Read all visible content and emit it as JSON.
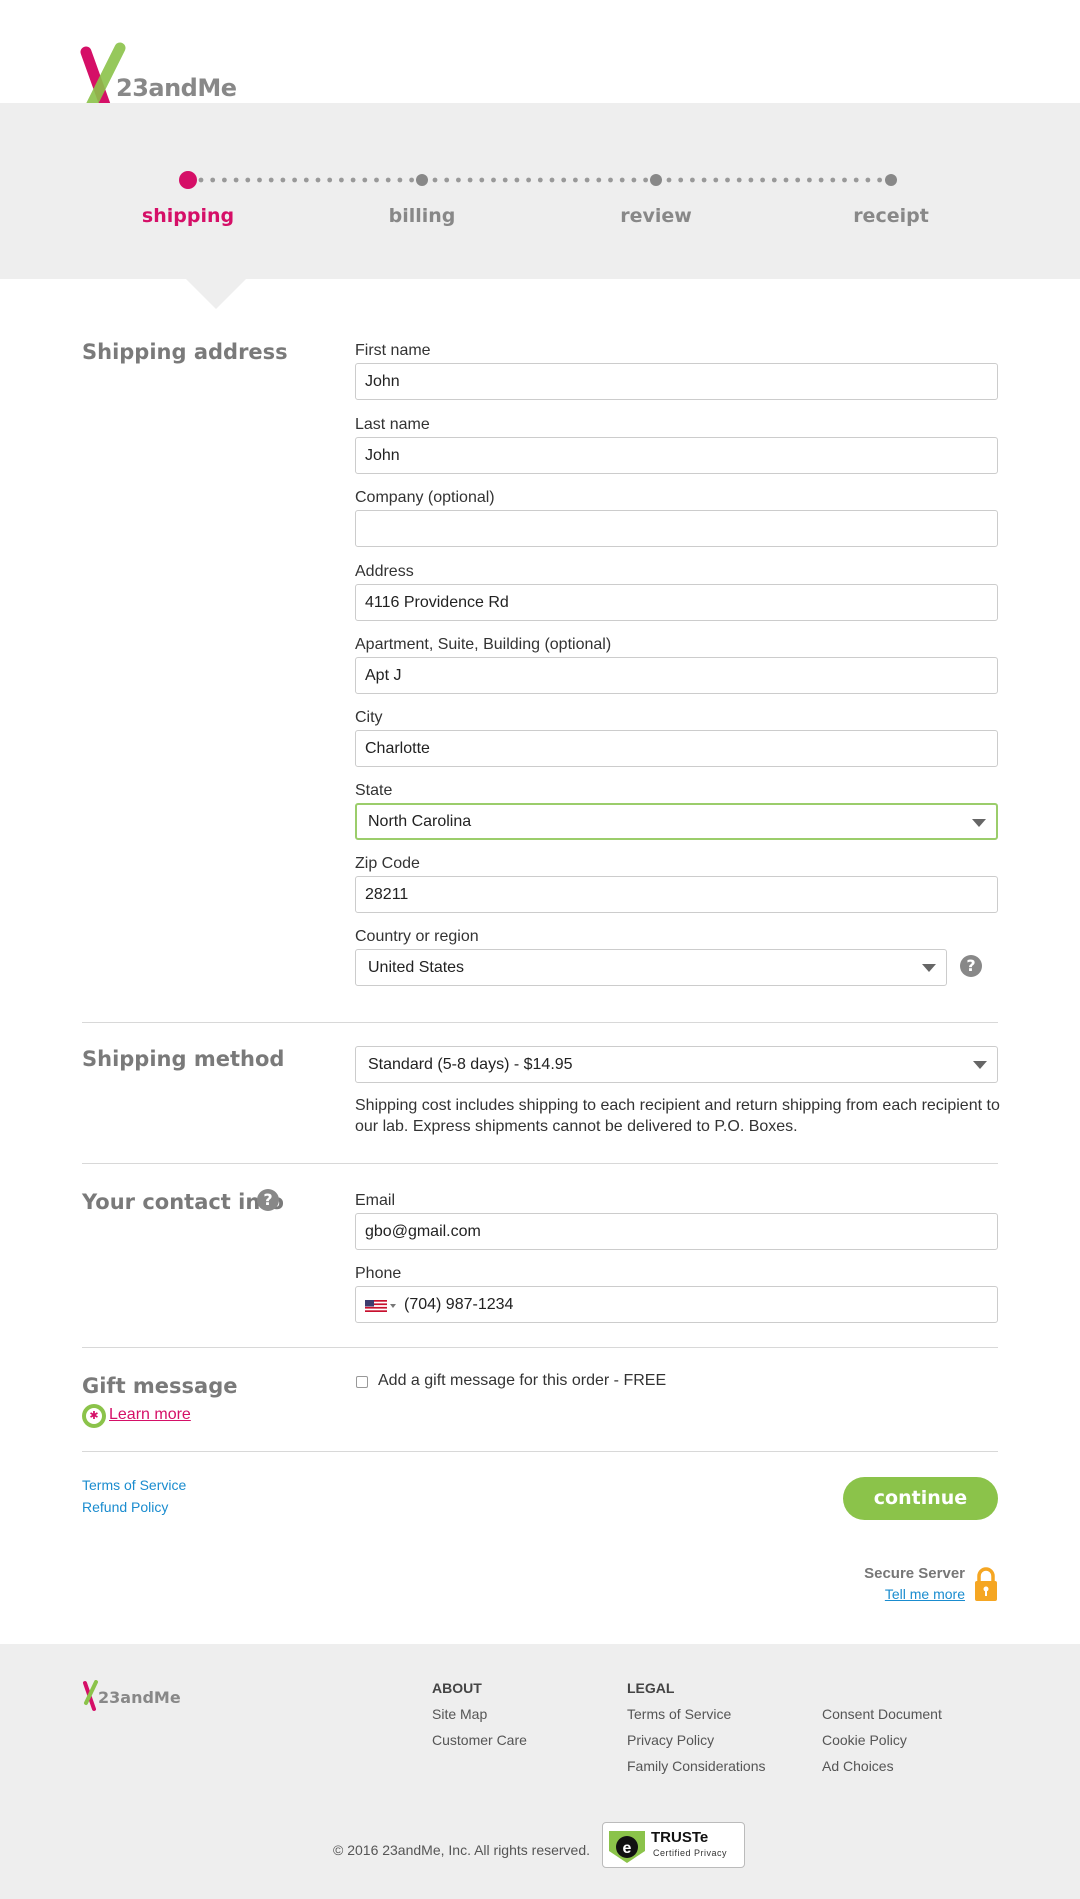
{
  "brand": {
    "name": "23andMe",
    "accent_color": "#d50f67",
    "green_color": "#8bc34a"
  },
  "steps": [
    {
      "label": "shipping",
      "active": true
    },
    {
      "label": "billing",
      "active": false
    },
    {
      "label": "review",
      "active": false
    },
    {
      "label": "receipt",
      "active": false
    }
  ],
  "shipping_address": {
    "title": "Shipping address",
    "first_name_label": "First name",
    "first_name": "John",
    "last_name_label": "Last name",
    "last_name": "John",
    "company_label": "Company (optional)",
    "company": "",
    "address_label": "Address",
    "address": "4116 Providence Rd",
    "apartment_label": "Apartment, Suite, Building (optional)",
    "apartment": "Apt J",
    "city_label": "City",
    "city": "Charlotte",
    "state_label": "State",
    "state": "North Carolina",
    "zip_label": "Zip Code",
    "zip": "28211",
    "country_label": "Country or region",
    "country": "United States",
    "country_help_icon": "question-circle-icon"
  },
  "shipping_method": {
    "title": "Shipping method",
    "selected": "Standard (5-8 days) - $14.95",
    "note": "Shipping cost includes shipping to each recipient and return shipping from each recipient to our lab. Express shipments cannot be delivered to P.O. Boxes."
  },
  "contact": {
    "title": "Your contact info",
    "email_label": "Email",
    "email": "gbo@gmail.com",
    "phone_label": "Phone",
    "phone": "(704) 987-1234"
  },
  "gift": {
    "title": "Gift message",
    "learn_more": "Learn more",
    "checkbox_label": "Add a gift message for this order - FREE",
    "checked": false
  },
  "actions": {
    "terms": "Terms of Service",
    "refund": "Refund Policy",
    "continue": "continue"
  },
  "secure": {
    "label": "Secure Server",
    "link": "Tell me more"
  },
  "footer": {
    "logo_text": "23andMe",
    "about_heading": "ABOUT",
    "about_links": [
      "Site Map",
      "Customer Care"
    ],
    "legal_heading": "LEGAL",
    "legal_links_col1": [
      "Terms of Service",
      "Privacy Policy",
      "Family Considerations"
    ],
    "legal_links_col2": [
      "Consent Document",
      "Cookie Policy",
      "Ad Choices"
    ],
    "copyright": "© 2016 23andMe, Inc. All rights reserved.",
    "truste_name": "TRUSTe",
    "truste_sub": "Certified Privacy"
  }
}
